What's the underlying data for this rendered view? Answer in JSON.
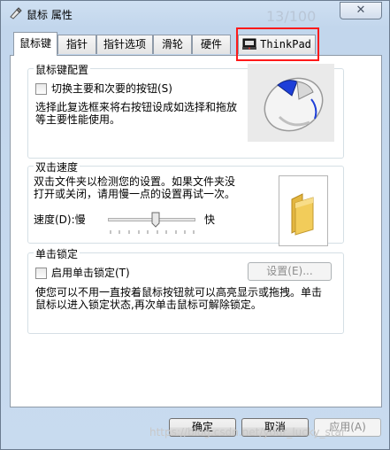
{
  "window": {
    "title": "鼠标 属性",
    "close_label": "✕",
    "faint_title_text": "13/100"
  },
  "tabs": [
    {
      "label": "鼠标键",
      "active": true
    },
    {
      "label": "指针"
    },
    {
      "label": "指针选项"
    },
    {
      "label": "滑轮"
    },
    {
      "label": "硬件"
    },
    {
      "label": "ThinkPad",
      "icon": "thinkpad-icon"
    }
  ],
  "buttons_config": {
    "title": "鼠标键配置",
    "checkbox_label": "切换主要和次要的按钮(S)",
    "description_line1": "选择此复选框来将右按钮设成如选择和拖放",
    "description_line2": "等主要性能使用。",
    "image_icon": "mouse-icon"
  },
  "double_click": {
    "title": "双击速度",
    "description_line1": "双击文件夹以检测您的设置。如果文件夹没",
    "description_line2": "打开或关闭，请用慢一点的设置再试一次。",
    "speed_label": "速度(D):慢",
    "fast_label": "快",
    "speed_value": 0.55,
    "folder_icon": "folder-icon"
  },
  "click_lock": {
    "title": "单击锁定",
    "checkbox_label": "启用单击锁定(T)",
    "settings_button": "设置(E)...",
    "description_line1": "使您可以不用一直按着鼠标按钮就可以高亮显示或拖拽。单击",
    "description_line2": "鼠标以进入锁定状态,再次单击鼠标可解除锁定。"
  },
  "footer": {
    "ok_label": "确定",
    "cancel_label": "取消",
    "apply_label": "应用(A)"
  },
  "watermark": "https://blog.csdn.net/your_lucky_star",
  "colors": {
    "highlight": "#ff1a1a",
    "mouse_accent": "#1e3fd8",
    "folder": "#f2cc5a"
  }
}
